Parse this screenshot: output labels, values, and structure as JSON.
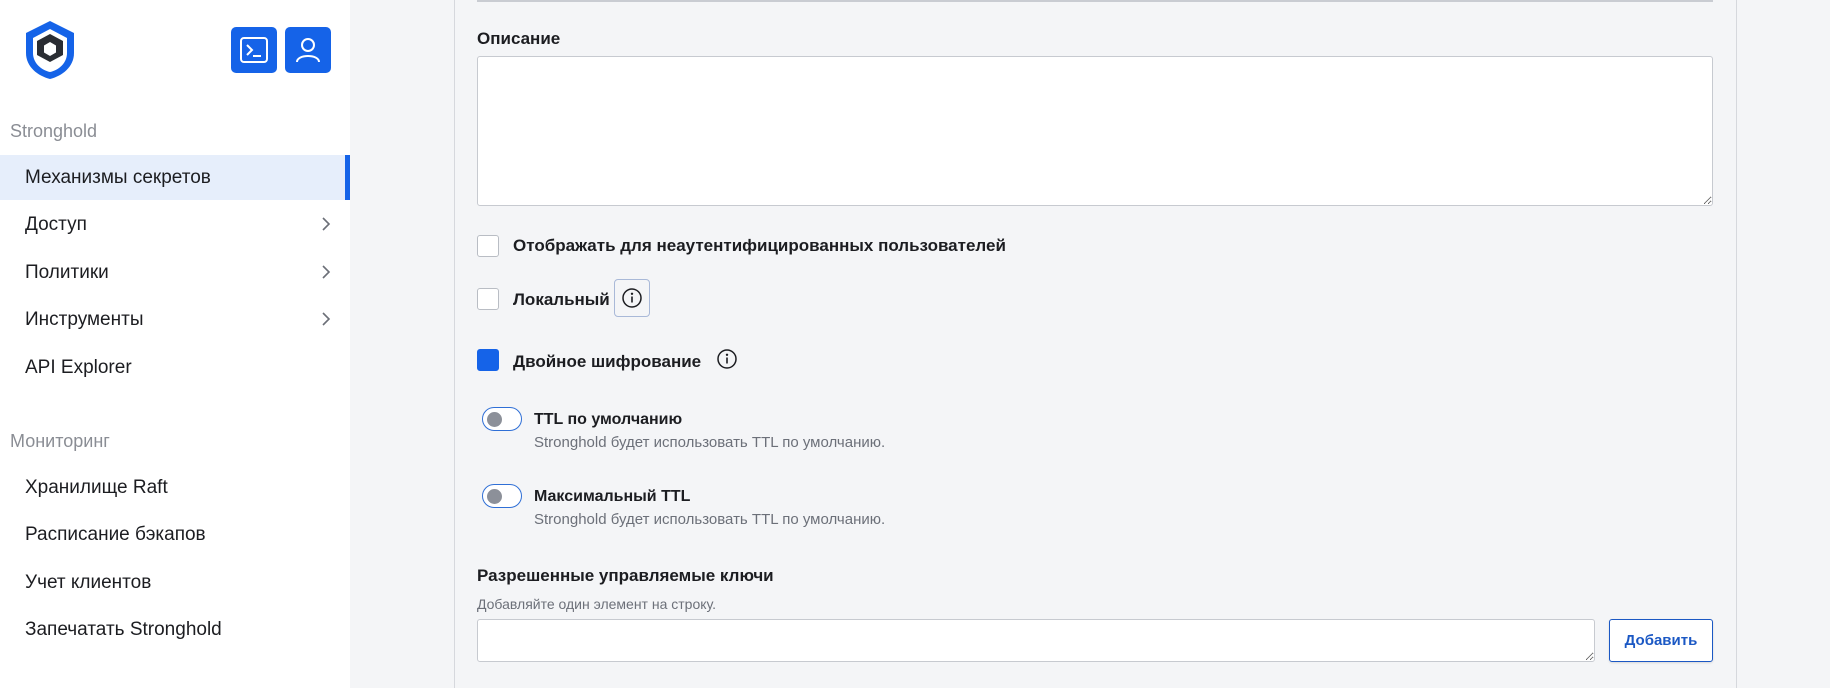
{
  "sidebar": {
    "section1_title": "Stronghold",
    "nav1": [
      {
        "label": "Механизмы секретов",
        "active": true
      },
      {
        "label": "Доступ"
      },
      {
        "label": "Политики"
      },
      {
        "label": "Инструменты"
      },
      {
        "label": "API Explorer"
      }
    ],
    "section2_title": "Мониторинг",
    "nav2": [
      {
        "label": "Хранилище Raft"
      },
      {
        "label": "Расписание бэкапов"
      },
      {
        "label": "Учет клиентов"
      },
      {
        "label": "Запечатать Stronghold"
      }
    ]
  },
  "form": {
    "description_label": "Описание",
    "description_value": "",
    "show_unauth_label": "Отображать для неаутентифицированных пользователей",
    "show_unauth_checked": false,
    "local_label": "Локальный",
    "local_checked": false,
    "double_encrypt_label": "Двойное шифрование",
    "double_encrypt_checked": true,
    "default_ttl": {
      "title": "TTL по умолчанию",
      "help": "Stronghold будет использовать TTL по умолчанию.",
      "enabled": false
    },
    "max_ttl": {
      "title": "Максимальный TTL",
      "help": "Stronghold будет использовать TTL по умолчанию.",
      "enabled": false
    },
    "managed_keys_label": "Разрешенные управляемые ключи",
    "managed_keys_help": "Добавляйте один элемент на строку.",
    "managed_keys_value": "",
    "add_button_label": "Добавить"
  },
  "colors": {
    "accent": "#1563e8",
    "sidebar_active_bg": "#e6eefb",
    "page_bg": "#f4f5f7"
  },
  "icons": [
    "stronghold-logo",
    "terminal-icon",
    "user-icon",
    "chevron-right-icon",
    "info-icon"
  ]
}
